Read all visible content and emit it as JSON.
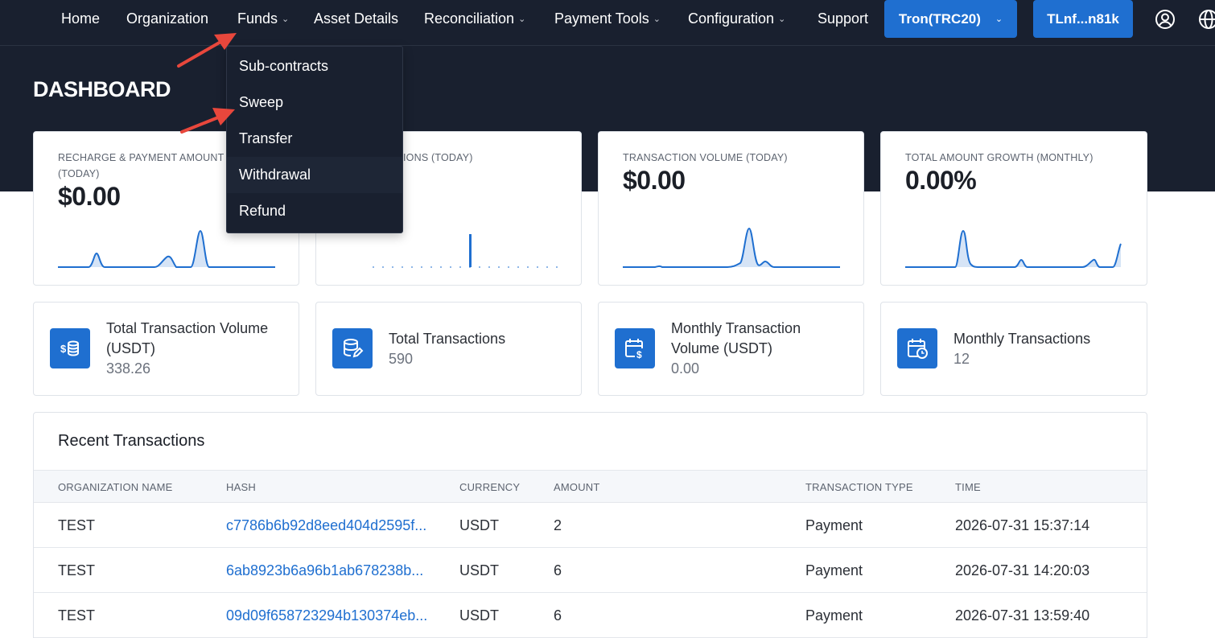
{
  "nav": {
    "items": [
      {
        "label": "Home",
        "has_dropdown": false
      },
      {
        "label": "Organization",
        "has_dropdown": false
      },
      {
        "label": "Funds",
        "has_dropdown": true
      },
      {
        "label": "Asset Details",
        "has_dropdown": false
      },
      {
        "label": "Reconciliation",
        "has_dropdown": true
      },
      {
        "label": "Payment Tools",
        "has_dropdown": true
      },
      {
        "label": "Configuration",
        "has_dropdown": true
      },
      {
        "label": "Support",
        "has_dropdown": false
      }
    ],
    "network_button": "Tron(TRC20)",
    "wallet_button": "TLnf...n81k",
    "icons": [
      "user-circle-icon",
      "globe-icon"
    ]
  },
  "funds_menu": {
    "items": [
      "Sub-contracts",
      "Sweep",
      "Transfer",
      "Withdrawal",
      "Refund"
    ],
    "hovered": "Withdrawal"
  },
  "page": {
    "title": "DASHBOARD"
  },
  "stat_cards": [
    {
      "title_line1": "RECHARGE & PAYMENT AMOUNT",
      "title_line2": "(TODAY)",
      "value": "$0.00"
    },
    {
      "title_line1": "TRANSACTIONS (TODAY)",
      "title_visible": "IONS (TODAY)",
      "value": ""
    },
    {
      "title_line1": "TRANSACTION VOLUME (TODAY)",
      "value": "$0.00"
    },
    {
      "title_line1": "TOTAL AMOUNT GROWTH (MONTHLY)",
      "value": "0.00%"
    }
  ],
  "info_cards": [
    {
      "label": "Total Transaction Volume (USDT)",
      "value": "338.26",
      "icon": "dollar-coins-icon"
    },
    {
      "label": "Total Transactions",
      "value": "590",
      "icon": "database-edit-icon"
    },
    {
      "label": "Monthly Transaction Volume (USDT)",
      "value": "0.00",
      "icon": "calendar-dollar-icon"
    },
    {
      "label": "Monthly Transactions",
      "value": "12",
      "icon": "calendar-clock-icon"
    }
  ],
  "recent": {
    "title": "Recent Transactions",
    "columns": [
      "ORGANIZATION NAME",
      "HASH",
      "CURRENCY",
      "AMOUNT",
      "TRANSACTION TYPE",
      "TIME"
    ],
    "rows": [
      {
        "org": "TEST",
        "hash": "c7786b6b92d8eed404d2595f...",
        "currency": "USDT",
        "amount": "2",
        "type": "Payment",
        "time": "2026-07-31 15:37:14"
      },
      {
        "org": "TEST",
        "hash": "6ab8923b6a96b1ab678238b...",
        "currency": "USDT",
        "amount": "6",
        "type": "Payment",
        "time": "2026-07-31 14:20:03"
      },
      {
        "org": "TEST",
        "hash": "09d09f658723294b130374eb...",
        "currency": "USDT",
        "amount": "6",
        "type": "Payment",
        "time": "2026-07-31 13:59:40"
      }
    ]
  },
  "colors": {
    "nav_bg": "#19202f",
    "accent": "#1f6fd0",
    "annotation_arrow": "#e8473c"
  }
}
